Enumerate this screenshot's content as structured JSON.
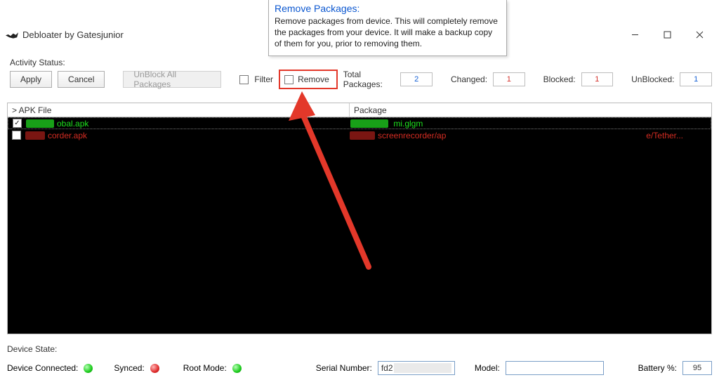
{
  "tooltip": {
    "title": "Remove Packages:",
    "body": "Remove packages from device.  This will completely remove the packages from your device.  It will make a backup copy of them for you, prior to removing them."
  },
  "window": {
    "title": "Debloater by Gatesjunior"
  },
  "activity": {
    "label": "Activity Status:",
    "apply": "Apply",
    "cancel": "Cancel",
    "unblock_all": "UnBlock All Packages",
    "filter": "Filter",
    "remove": "Remove",
    "total_label": "Total Packages:",
    "total_val": "2",
    "changed_label": "Changed:",
    "changed_val": "1",
    "blocked_label": "Blocked:",
    "blocked_val": "1",
    "unblocked_label": "UnBlocked:",
    "unblocked_val": "1"
  },
  "table": {
    "col_apk": "> APK File",
    "col_pkg": "Package",
    "rows": [
      {
        "checked": true,
        "apk_suffix": "obal.apk",
        "pkg_suffix": "mi.glgm",
        "color": "green"
      },
      {
        "checked": false,
        "apk_suffix": "corder.apk",
        "pkg_suffix": "screenrecorder/ap",
        "pkg_tail": "e/Tether...",
        "color": "red"
      }
    ]
  },
  "device": {
    "state_label": "Device State:",
    "connected_label": "Device Connected:",
    "synced_label": "Synced:",
    "root_label": "Root Mode:",
    "serial_label": "Serial Number:",
    "serial_val": "fd2",
    "model_label": "Model:",
    "battery_label": "Battery %:",
    "battery_val": "95"
  }
}
